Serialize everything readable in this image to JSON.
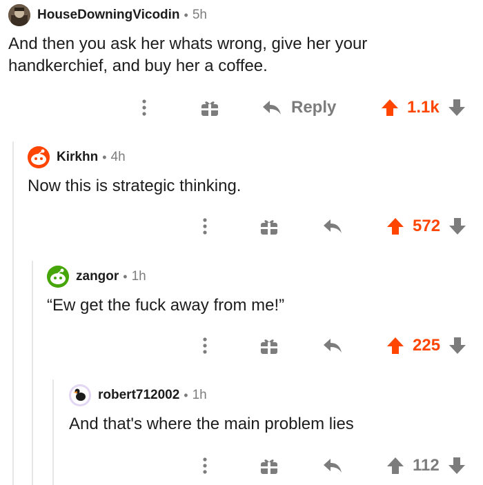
{
  "colors": {
    "upvoted": "#ff4500",
    "muted": "#7c7c7c",
    "text": "#1c1c1c",
    "thread_line": "#e6e6e6"
  },
  "comments": [
    {
      "username": "HouseDowningVicodin",
      "age": "5h",
      "body": "And then you ask her whats wrong, give her your handkerchief, and buy her a coffee.",
      "reply_label": "Reply",
      "score": "1.1k",
      "upvoted": true
    },
    {
      "username": "Kirkhn",
      "age": "4h",
      "body": "Now this is strategic thinking.",
      "score": "572",
      "upvoted": true
    },
    {
      "username": "zangor",
      "age": "1h",
      "body": "“Ew get the fuck away from me!”",
      "score": "225",
      "upvoted": true
    },
    {
      "username": "robert712002",
      "age": "1h",
      "body": "And that's where the main problem lies",
      "score": "112",
      "upvoted": false
    }
  ],
  "separator": "•",
  "icons": [
    "more-icon",
    "gift-icon",
    "reply-icon",
    "upvote-icon",
    "downvote-icon"
  ]
}
